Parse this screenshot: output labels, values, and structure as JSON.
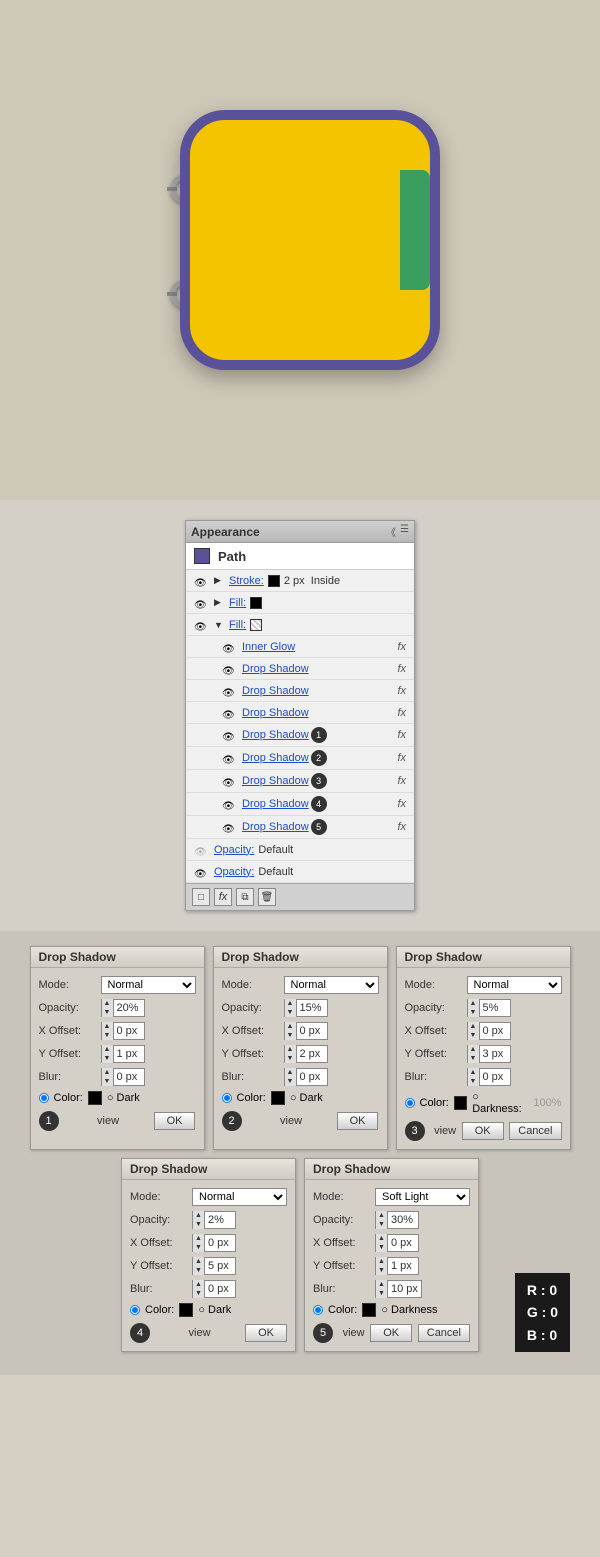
{
  "preview": {
    "bg_color": "#cec8b8"
  },
  "appearance": {
    "title": "Appearance",
    "panel_title": "Path",
    "rows": [
      {
        "type": "stroke",
        "label": "Stroke:",
        "swatch": "black",
        "suffix": "2 px  Inside",
        "fx": false,
        "arrow": "right"
      },
      {
        "type": "fill1",
        "label": "Fill:",
        "swatch": "black",
        "fx": false,
        "arrow": "right"
      },
      {
        "type": "fill2",
        "label": "Fill:",
        "swatch": "pattern",
        "fx": false,
        "arrow": "down"
      },
      {
        "type": "fx",
        "label": "Inner Glow",
        "fx": true
      },
      {
        "type": "fx",
        "label": "Drop Shadow",
        "fx": true,
        "badge": ""
      },
      {
        "type": "fx",
        "label": "Drop Shadow",
        "fx": true,
        "badge": ""
      },
      {
        "type": "fx",
        "label": "Drop Shadow",
        "fx": true,
        "badge": ""
      },
      {
        "type": "fx",
        "label": "Drop Shadow",
        "fx": true,
        "badge": "1"
      },
      {
        "type": "fx",
        "label": "Drop Shadow",
        "fx": true,
        "badge": "2"
      },
      {
        "type": "fx",
        "label": "Drop Shadow",
        "fx": true,
        "badge": "3"
      },
      {
        "type": "fx",
        "label": "Drop Shadow",
        "fx": true,
        "badge": "4"
      },
      {
        "type": "fx",
        "label": "Drop Shadow",
        "fx": true,
        "badge": "5"
      },
      {
        "type": "opacity",
        "label": "Opacity:",
        "value": "Default",
        "link": true
      },
      {
        "type": "opacity",
        "label": "Opacity:",
        "value": "Default",
        "link": false
      }
    ]
  },
  "drop_shadows": [
    {
      "id": 1,
      "title": "Drop Shadow",
      "mode": "Normal",
      "opacity": "20%",
      "x_offset": "0 px",
      "y_offset": "1 px",
      "blur": "0 px",
      "badge": "1",
      "show_cancel": false
    },
    {
      "id": 2,
      "title": "Drop Shadow",
      "mode": "Normal",
      "opacity": "15%",
      "x_offset": "0 px",
      "y_offset": "2 px",
      "blur": "0 px",
      "badge": "2",
      "show_cancel": false
    },
    {
      "id": 3,
      "title": "Drop Shadow",
      "mode": "Normal",
      "opacity": "5%",
      "x_offset": "0 px",
      "y_offset": "3 px",
      "blur": "0 px",
      "badge": "3",
      "show_cancel": true,
      "darkness_disabled": false
    },
    {
      "id": 4,
      "title": "Drop Shadow",
      "mode": "Normal",
      "opacity": "2%",
      "x_offset": "0 px",
      "y_offset": "5 px",
      "blur": "0 px",
      "badge": "4",
      "show_cancel": false
    },
    {
      "id": 5,
      "title": "Drop Shadow",
      "mode": "Soft Light",
      "opacity": "30%",
      "x_offset": "0 px",
      "y_offset": "1 px",
      "blur": "10 px",
      "badge": "5",
      "show_cancel": true,
      "show_rgb": true,
      "rgb": {
        "r": 0,
        "g": 0,
        "b": 0
      }
    }
  ],
  "labels": {
    "mode": "Mode:",
    "opacity": "Opacity:",
    "x_offset": "X Offset:",
    "y_offset": "Y Offset:",
    "blur": "Blur:",
    "color": "Color:",
    "darkness": "Darkness:",
    "darkness_pct": "100%",
    "ok": "OK",
    "cancel": "Cancel",
    "preview": "view"
  }
}
